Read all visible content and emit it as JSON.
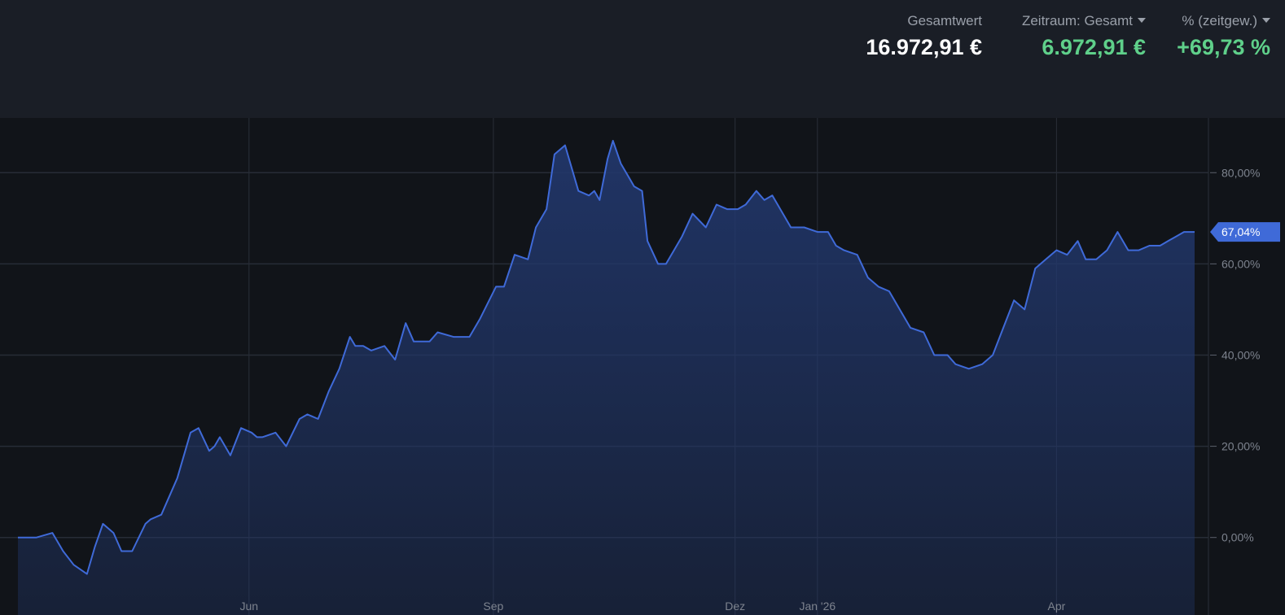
{
  "header": {
    "total": {
      "label": "Gesamtwert",
      "value": "16.972,91 €"
    },
    "period": {
      "label": "Zeitraum: Gesamt",
      "value": "6.972,91 €"
    },
    "percent": {
      "label": "% (zeitgew.)",
      "value": "+69,73 %"
    }
  },
  "colors": {
    "header_bg": "#1a1e26",
    "chart_bg": "#111419",
    "positive": "#5fd08a",
    "line": "#3f6ad8",
    "area": "#22386e",
    "current_badge": "#3f6ad8"
  },
  "chart_data": {
    "type": "area",
    "x_label": "",
    "y_label": "",
    "ylim": [
      -17,
      92
    ],
    "y_ticks": [
      0,
      20,
      40,
      60,
      80
    ],
    "y_tick_labels": [
      "0,00%",
      "20,00%",
      "40,00%",
      "60,00%",
      "80,00%"
    ],
    "y_axis_position": "right",
    "x_ticks": [
      "Jun",
      "Sep",
      "Dez",
      "Jan '26",
      "Apr"
    ],
    "x_tick_positions": [
      "2025-06-01",
      "2025-09-01",
      "2025-12-01",
      "2026-01-01",
      "2026-04-01"
    ],
    "grid": true,
    "current_value_label": "67,04%",
    "series": [
      {
        "x": [
          "2025-03-06",
          "2025-03-13",
          "2025-03-19",
          "2025-03-23",
          "2025-03-27",
          "2025-04-01",
          "2025-04-04",
          "2025-04-07",
          "2025-04-11",
          "2025-04-14",
          "2025-04-18",
          "2025-04-23",
          "2025-04-25",
          "2025-04-29",
          "2025-05-05",
          "2025-05-10",
          "2025-05-13",
          "2025-05-17",
          "2025-05-19",
          "2025-05-21",
          "2025-05-25",
          "2025-05-29",
          "2025-06-02",
          "2025-06-04",
          "2025-06-06",
          "2025-06-11",
          "2025-06-15",
          "2025-06-20",
          "2025-06-23",
          "2025-06-27",
          "2025-07-01",
          "2025-07-05",
          "2025-07-09",
          "2025-07-11",
          "2025-07-14",
          "2025-07-17",
          "2025-07-22",
          "2025-07-26",
          "2025-07-30",
          "2025-08-02",
          "2025-08-05",
          "2025-08-08",
          "2025-08-11",
          "2025-08-17",
          "2025-08-23",
          "2025-08-27",
          "2025-09-02",
          "2025-09-05",
          "2025-09-09",
          "2025-09-14",
          "2025-09-17",
          "2025-09-21",
          "2025-09-24",
          "2025-09-28",
          "2025-10-03",
          "2025-10-07",
          "2025-10-09",
          "2025-10-11",
          "2025-10-14",
          "2025-10-16",
          "2025-10-19",
          "2025-10-22",
          "2025-10-24",
          "2025-10-27",
          "2025-10-29",
          "2025-11-02",
          "2025-11-05",
          "2025-11-08",
          "2025-11-11",
          "2025-11-15",
          "2025-11-20",
          "2025-11-24",
          "2025-11-28",
          "2025-12-02",
          "2025-12-05",
          "2025-12-09",
          "2025-12-12",
          "2025-12-15",
          "2025-12-18",
          "2025-12-22",
          "2025-12-27",
          "2026-01-01",
          "2026-01-05",
          "2026-01-08",
          "2026-01-11",
          "2026-01-16",
          "2026-01-20",
          "2026-01-24",
          "2026-01-28",
          "2026-02-01",
          "2026-02-05",
          "2026-02-10",
          "2026-02-14",
          "2026-02-17",
          "2026-02-19",
          "2026-02-22",
          "2026-02-27",
          "2026-03-04",
          "2026-03-08",
          "2026-03-12",
          "2026-03-16",
          "2026-03-20",
          "2026-03-24",
          "2026-03-28",
          "2026-04-01",
          "2026-04-05",
          "2026-04-09",
          "2026-04-12",
          "2026-04-16",
          "2026-04-20",
          "2026-04-24",
          "2026-04-28",
          "2026-05-02",
          "2026-05-06",
          "2026-05-10",
          "2026-05-13",
          "2026-05-16",
          "2026-05-19",
          "2026-05-21",
          "2026-05-23"
        ],
        "y": [
          0,
          0,
          1,
          -3,
          -6,
          -8,
          -2,
          3,
          1,
          -3,
          -3,
          3,
          4,
          5,
          13,
          23,
          24,
          19,
          20,
          22,
          18,
          24,
          23,
          22,
          22,
          23,
          20,
          26,
          27,
          26,
          32,
          37,
          44,
          42,
          42,
          41,
          42,
          39,
          47,
          43,
          43,
          43,
          45,
          44,
          44,
          48,
          55,
          55,
          62,
          61,
          68,
          72,
          84,
          86,
          76,
          75,
          76,
          74,
          83,
          87,
          82,
          79,
          77,
          76,
          65,
          60,
          60,
          63,
          66,
          71,
          68,
          73,
          72,
          72,
          73,
          76,
          74,
          75,
          72,
          68,
          68,
          67,
          67,
          64,
          63,
          62,
          57,
          55,
          54,
          50,
          46,
          45,
          40,
          40,
          40,
          38,
          37,
          38,
          40,
          46,
          52,
          50,
          59,
          61,
          63,
          62,
          65,
          61,
          61,
          63,
          67,
          63,
          63,
          64,
          64,
          65,
          66,
          67,
          67,
          67
        ],
        "color": "#3f6ad8"
      }
    ]
  }
}
